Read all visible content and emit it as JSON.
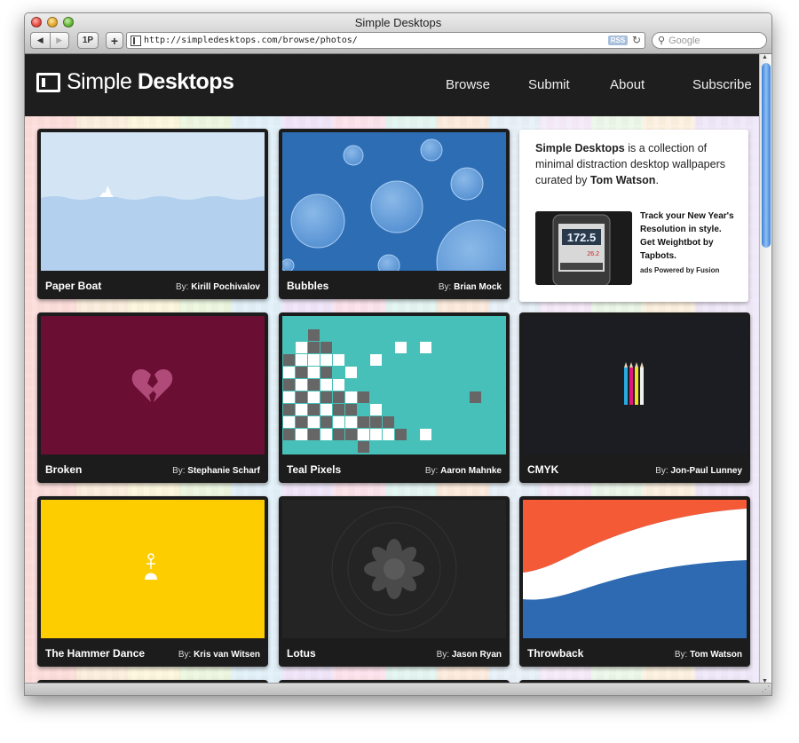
{
  "window": {
    "title": "Simple Desktops"
  },
  "toolbar": {
    "back_glyph": "◀",
    "forward_glyph": "▶",
    "onepassword_label": "1P",
    "add_label": "+",
    "url": "http://simpledesktops.com/browse/photos/",
    "rss_label": "RSS",
    "reload_glyph": "↻",
    "search_placeholder": "Google",
    "search_glyph": "⚲"
  },
  "site": {
    "logo_light": "Simple",
    "logo_bold": "Desktops",
    "nav": [
      "Browse",
      "Submit",
      "About",
      "Subscribe"
    ]
  },
  "about": {
    "brand": "Simple Desktops",
    "text_middle": " is a collection of minimal distraction desktop wallpapers curated by ",
    "curator": "Tom Watson",
    "end": ".",
    "ad_text": "Track your New Year's Resolution in style. Get Weightbot by Tapbots.",
    "ad_powered": "ads Powered by Fusion",
    "ad_weight_main": "172.5",
    "ad_weight_small": "26.2"
  },
  "by_prefix": "By:",
  "cards": [
    {
      "title": "Paper Boat",
      "author": "Kirill Pochivalov",
      "colors": {
        "sky": "#d3e4f4",
        "sea": "#b3d1ef"
      }
    },
    {
      "title": "Bubbles",
      "author": "Brian Mock",
      "colors": {
        "bg": "#2d6db4",
        "bubble": "#6aa3dd"
      }
    },
    {
      "title": "Broken",
      "author": "Stephanie Scharf",
      "colors": {
        "bg": "#6b0e34",
        "heart": "#b04a78"
      }
    },
    {
      "title": "Teal Pixels",
      "author": "Aaron Mahnke",
      "colors": {
        "bg": "#46c0b8",
        "dark": "#666666",
        "light": "#ffffff"
      }
    },
    {
      "title": "CMYK",
      "author": "Jon-Paul Lunney",
      "colors": {
        "bg": "#1b1d22"
      }
    },
    {
      "title": "The Hammer Dance",
      "author": "Kris van Witsen",
      "colors": {
        "bg": "#fecd00",
        "figure": "#ffffff"
      }
    },
    {
      "title": "Lotus",
      "author": "Jason Ryan",
      "colors": {
        "bg": "#242424",
        "lotus": "#4a4a4a"
      }
    },
    {
      "title": "Throwback",
      "author": "Tom Watson",
      "colors": {
        "red": "#f55a36",
        "white": "#ffffff",
        "blue": "#2e6ab2"
      }
    }
  ]
}
